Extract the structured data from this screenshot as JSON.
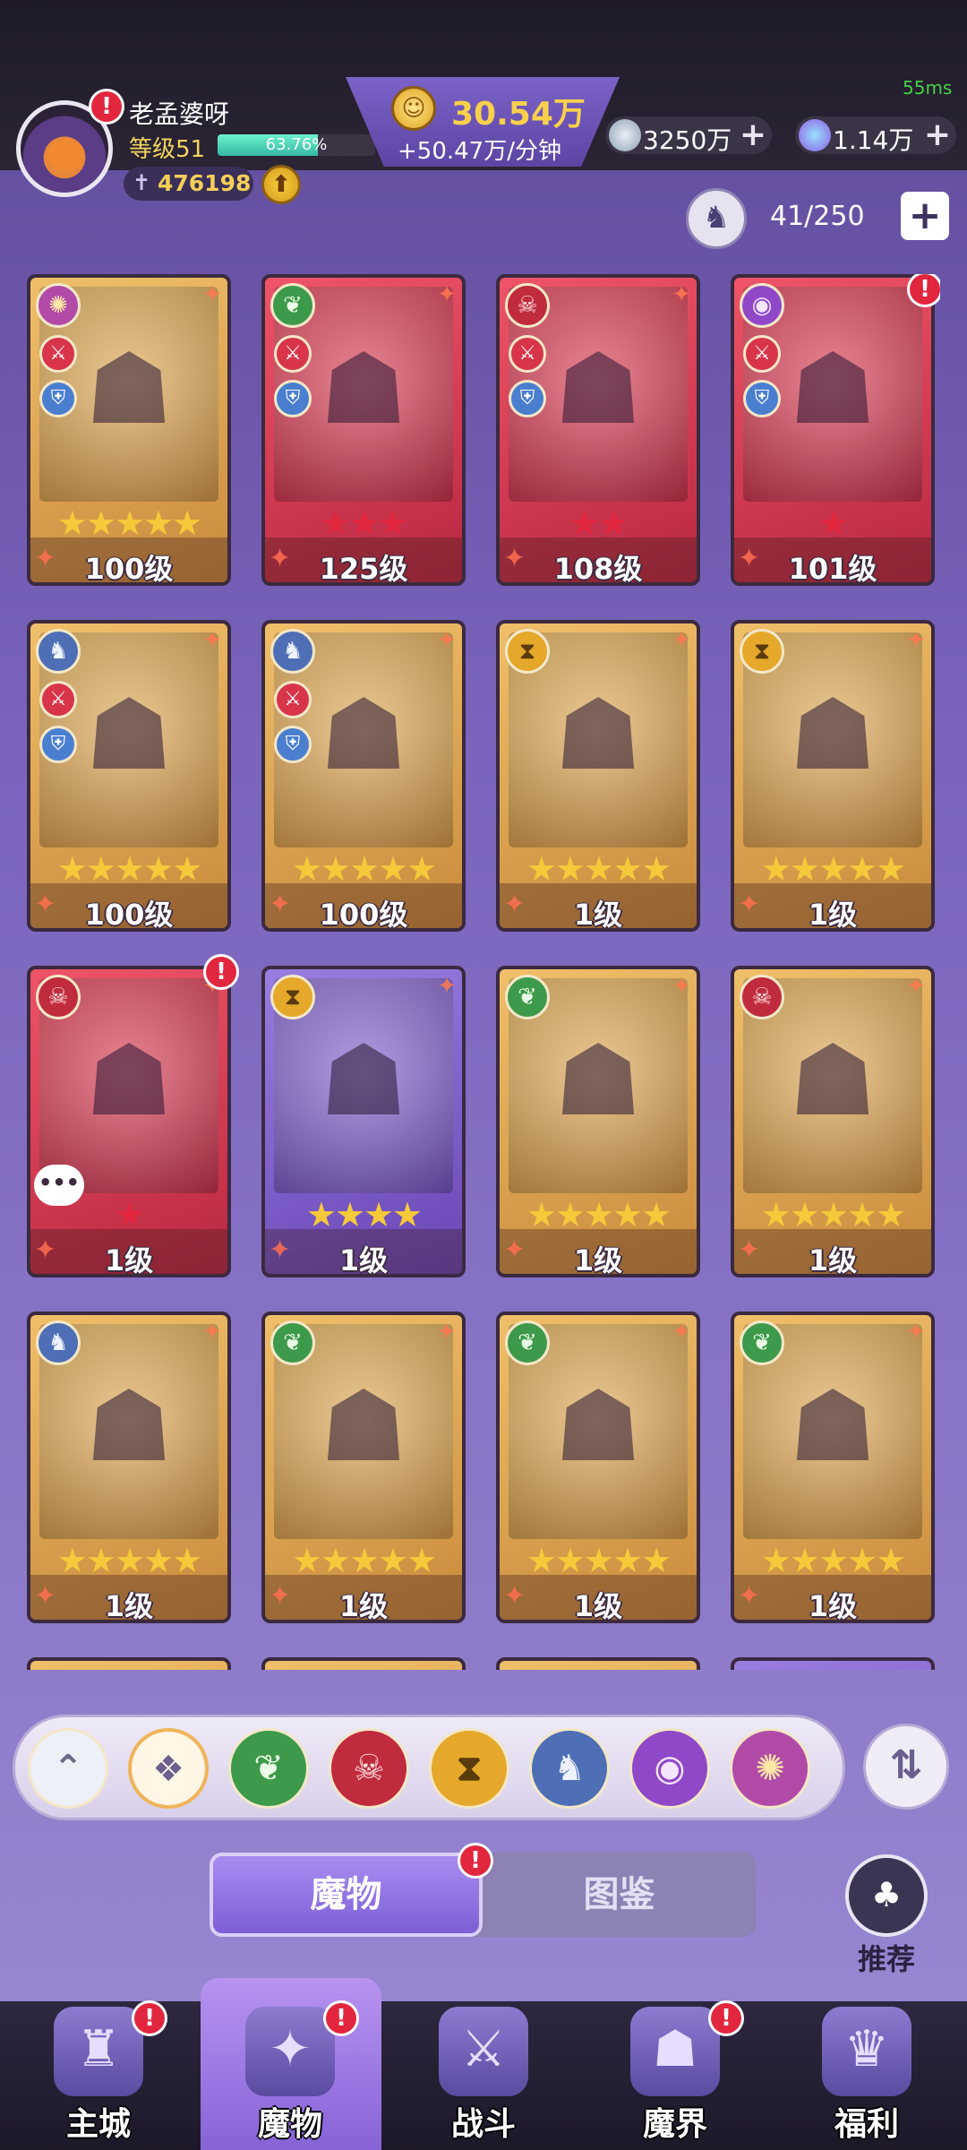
{
  "status": {
    "ping": "55ms"
  },
  "player": {
    "name": "老孟婆呀",
    "level_label": "等级51",
    "xp_percent_text": "63.76%",
    "xp_fraction": 0.6376,
    "power": "476198"
  },
  "currency": {
    "gold_amount": "30.54万",
    "gold_rate": "+50.47万/分钟",
    "silver_amount": "3250万",
    "gem_amount": "1.14万"
  },
  "capacity": {
    "text": "41/250",
    "plus": "+"
  },
  "cards": [
    {
      "level": "100级",
      "stars": "★★★★★",
      "star_color": "#f5c93a",
      "frame": "gold",
      "faction": "vortex",
      "has_roles": true
    },
    {
      "level": "125级",
      "stars": "★★★",
      "star_color": "#e2263d",
      "frame": "red",
      "faction": "leaf",
      "has_roles": true
    },
    {
      "level": "108级",
      "stars": "★★",
      "star_color": "#e2263d",
      "frame": "red",
      "faction": "demon",
      "has_roles": true
    },
    {
      "level": "101级",
      "stars": "★",
      "star_color": "#e2263d",
      "frame": "red",
      "faction": "eye",
      "has_roles": true,
      "alert": true
    },
    {
      "level": "100级",
      "stars": "★★★★★",
      "star_color": "#f5c93a",
      "frame": "gold",
      "faction": "dragon",
      "has_roles": true
    },
    {
      "level": "100级",
      "stars": "★★★★★",
      "star_color": "#f5c93a",
      "frame": "gold",
      "faction": "dragon",
      "has_roles": true
    },
    {
      "level": "1级",
      "stars": "★★★★★",
      "star_color": "#f5c93a",
      "frame": "gold",
      "faction": "hourglass"
    },
    {
      "level": "1级",
      "stars": "★★★★★",
      "star_color": "#f5c93a",
      "frame": "gold",
      "faction": "hourglass"
    },
    {
      "level": "1级",
      "stars": "★",
      "star_color": "#e2263d",
      "frame": "red",
      "faction": "demon",
      "alert": true,
      "chat": true
    },
    {
      "level": "1级",
      "stars": "★★★★",
      "star_color": "#f5c93a",
      "frame": "purple",
      "faction": "hourglass"
    },
    {
      "level": "1级",
      "stars": "★★★★★",
      "star_color": "#f5c93a",
      "frame": "gold",
      "faction": "leaf"
    },
    {
      "level": "1级",
      "stars": "★★★★★",
      "star_color": "#f5c93a",
      "frame": "gold",
      "faction": "demon"
    },
    {
      "level": "1级",
      "stars": "★★★★★",
      "star_color": "#f5c93a",
      "frame": "gold",
      "faction": "dragon"
    },
    {
      "level": "1级",
      "stars": "★★★★★",
      "star_color": "#f5c93a",
      "frame": "gold",
      "faction": "leaf"
    },
    {
      "level": "1级",
      "stars": "★★★★★",
      "star_color": "#f5c93a",
      "frame": "gold",
      "faction": "leaf"
    },
    {
      "level": "1级",
      "stars": "★★★★★",
      "star_color": "#f5c93a",
      "frame": "gold",
      "faction": "leaf"
    }
  ],
  "filters": [
    {
      "icon": "collapse-icon",
      "glyph": "⌃",
      "bg": "#eef0f8",
      "fg": "#6b6a88"
    },
    {
      "icon": "all-icon",
      "glyph": "❖",
      "bg": "#fff6e6",
      "fg": "#6b5f8f"
    },
    {
      "icon": "leaf-icon",
      "glyph": "❦",
      "bg": "#3d9a4a",
      "fg": "#eafbe6"
    },
    {
      "icon": "demon-icon",
      "glyph": "☠",
      "bg": "#c02b3d",
      "fg": "#ffe1e1"
    },
    {
      "icon": "hourglass-icon",
      "glyph": "⧗",
      "bg": "#e5a82a",
      "fg": "#5a3b0b"
    },
    {
      "icon": "dragon-icon",
      "glyph": "♞",
      "bg": "#4e6fb5",
      "fg": "#eef2ff"
    },
    {
      "icon": "eye-icon",
      "glyph": "◉",
      "bg": "#8f48c8",
      "fg": "#f5e6ff"
    },
    {
      "icon": "vortex-icon",
      "glyph": "✺",
      "bg": "#b24aa8",
      "fg": "#ffe9a6"
    }
  ],
  "tabs": {
    "monsters": "魔物",
    "codex": "图鉴"
  },
  "recommend_label": "推荐",
  "nav": [
    {
      "label": "主城",
      "icon": "castle-icon",
      "glyph": "♜"
    },
    {
      "label": "魔物",
      "icon": "monster-icon",
      "glyph": "✦"
    },
    {
      "label": "战斗",
      "icon": "battle-icon",
      "glyph": "⚔"
    },
    {
      "label": "魔界",
      "icon": "demon-realm-icon",
      "glyph": "☗"
    },
    {
      "label": "福利",
      "icon": "gift-icon",
      "glyph": "♛"
    }
  ]
}
